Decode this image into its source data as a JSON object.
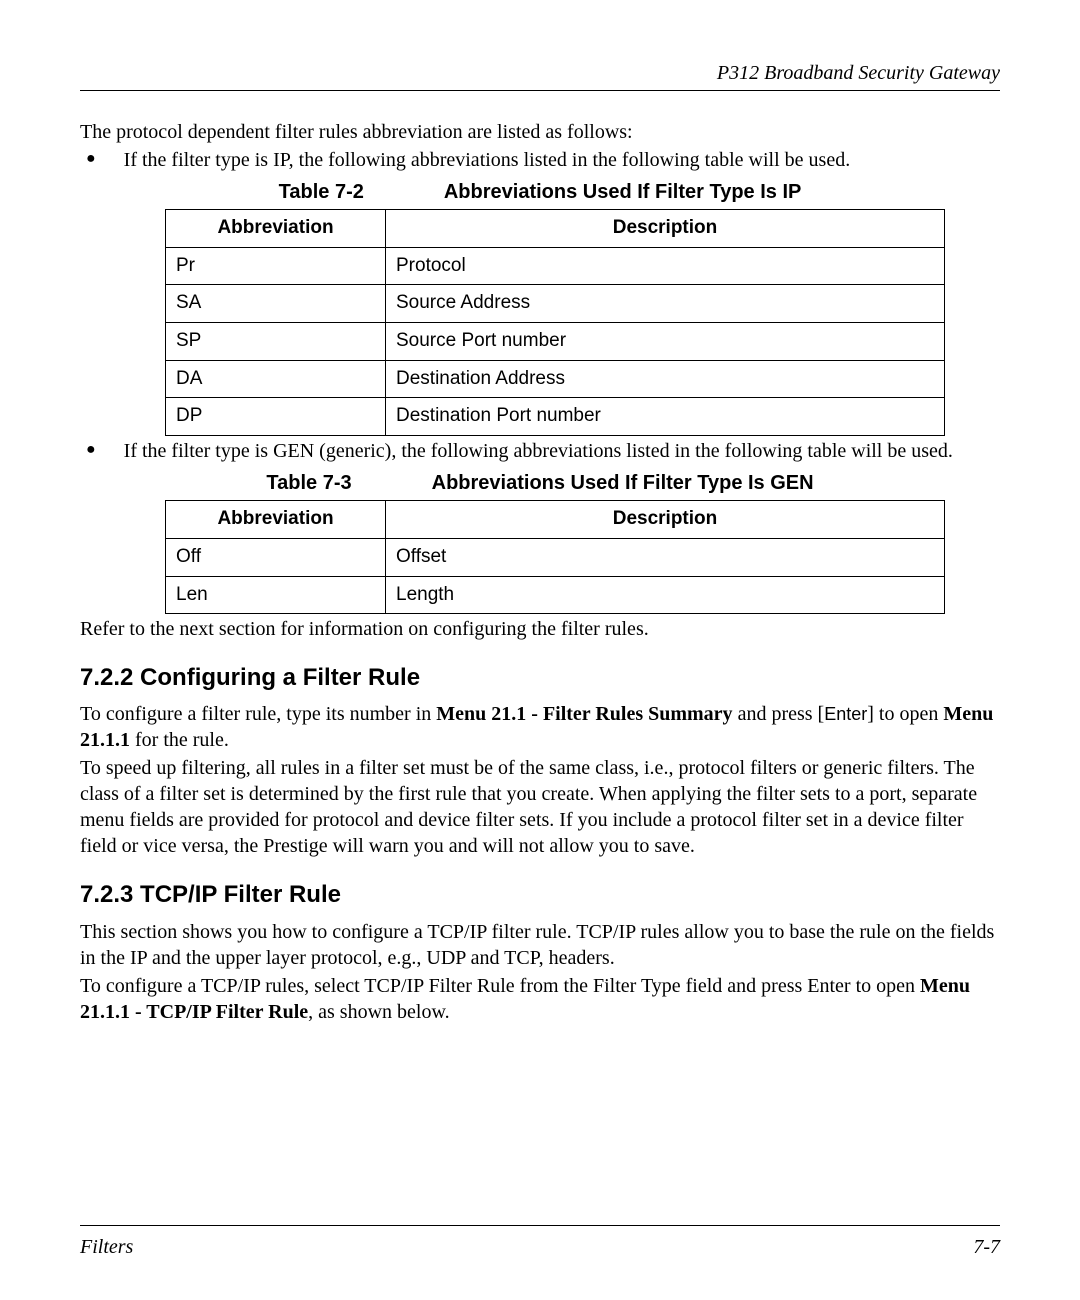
{
  "header": {
    "title": "P312  Broadband Security Gateway"
  },
  "intro": {
    "p1": "The protocol dependent filter rules abbreviation are listed as follows:",
    "bullet1": "If the filter type is IP, the following abbreviations listed in the following table will be used."
  },
  "table72": {
    "caption_num": "Table 7-2",
    "caption_text": "Abbreviations Used If Filter Type Is IP",
    "header1": "Abbreviation",
    "header2": "Description",
    "rows": [
      {
        "abbr": "Pr",
        "desc": "Protocol"
      },
      {
        "abbr": "SA",
        "desc": "Source Address"
      },
      {
        "abbr": "SP",
        "desc": "Source Port number"
      },
      {
        "abbr": "DA",
        "desc": "Destination Address"
      },
      {
        "abbr": "DP",
        "desc": "Destination Port number"
      }
    ]
  },
  "mid": {
    "bullet2": "If the filter type is GEN (generic), the following abbreviations listed in the following table will be used."
  },
  "table73": {
    "caption_num": "Table 7-3",
    "caption_text": "Abbreviations Used If Filter Type Is GEN",
    "header1": "Abbreviation",
    "header2": "Description",
    "rows": [
      {
        "abbr": "Off",
        "desc": "Offset"
      },
      {
        "abbr": "Len",
        "desc": "Length"
      }
    ]
  },
  "refer": "Refer to the next section for information on configuring the filter rules.",
  "section722": {
    "heading": "7.2.2  Configuring a Filter Rule",
    "p1_pre": "To configure a filter rule, type its number in ",
    "p1_bold1": "Menu 21.1 - Filter Rules Summary",
    "p1_mid": " and press [",
    "p1_enter": "Enter",
    "p1_post": "] to open ",
    "p1_bold2": "Menu 21.1.1",
    "p1_end": " for the rule.",
    "p2": "To speed up filtering, all rules in a filter set must be of the same class, i.e., protocol filters or generic filters. The class of a filter set is determined by the first rule that you create.  When applying the filter sets to a port, separate menu fields are provided for protocol and device filter sets.  If you include a protocol filter set in a device filter field or vice versa, the Prestige will warn you and will not allow you to save."
  },
  "section723": {
    "heading": "7.2.3  TCP/IP Filter Rule",
    "p1": "This section shows you how to configure a TCP/IP filter rule.  TCP/IP rules allow you to base the rule on the fields in the IP and the upper layer protocol, e.g., UDP and TCP, headers.",
    "p2_pre": "To configure a TCP/IP rules, select TCP/IP Filter Rule from the Filter Type field and press Enter to open ",
    "p2_bold": "Menu 21.1.1 - TCP/IP Filter Rule",
    "p2_post": ", as shown below."
  },
  "footer": {
    "left": "Filters",
    "right": "7-7"
  }
}
